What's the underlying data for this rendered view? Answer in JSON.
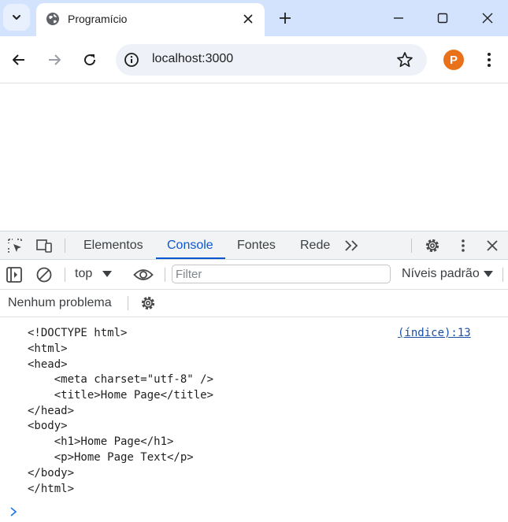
{
  "browser": {
    "tab_title": "Programício",
    "url": "localhost:3000",
    "profile_letter": "P",
    "accent": "#d3e3fd"
  },
  "devtools": {
    "tabs": [
      "Elementos",
      "Console",
      "Fontes",
      "Rede"
    ],
    "active_tab": "Console",
    "context": "top",
    "filter_placeholder": "Filter",
    "levels": "Níveis padrão",
    "issues": "Nenhum problema"
  },
  "console": {
    "source": "(índice):13",
    "lines": [
      "<!DOCTYPE html>",
      "<html>",
      "<head>",
      "    <meta charset=\"utf-8\" />",
      "    <title>Home Page</title>",
      "</head>",
      "<body>",
      "    <h1>Home Page</h1>",
      "    <p>Home Page Text</p>",
      "</body>",
      "</html>"
    ]
  },
  "icons": {
    "tab_search": "chevron-down-icon",
    "favicon": "globe-icon",
    "tab_close": "close-icon",
    "new_tab": "plus-icon",
    "back": "back-arrow-icon",
    "forward": "forward-arrow-icon",
    "reload": "reload-icon",
    "site_info": "info-icon",
    "bookmark": "star-icon",
    "menu": "kebab-menu-icon",
    "inspect": "inspect-element-icon",
    "device": "device-toolbar-icon",
    "more_tabs": "double-chevron-right-icon",
    "settings": "gear-icon",
    "sidebar": "sidebar-toggle-icon",
    "clear": "clear-console-icon",
    "live_expression": "eye-icon",
    "prompt": "chevron-right-icon"
  }
}
